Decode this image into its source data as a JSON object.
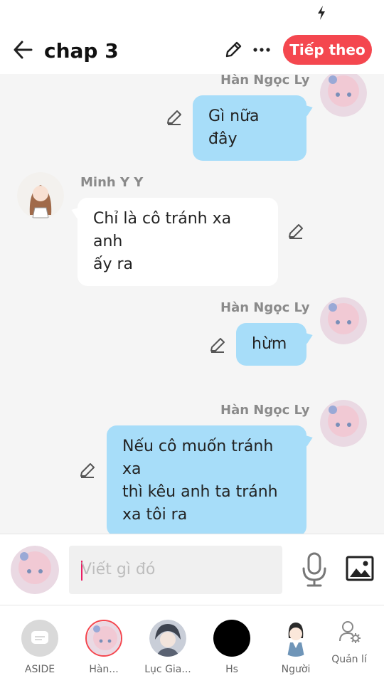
{
  "status": {
    "icon": "flash-icon"
  },
  "header": {
    "title": "chap 3",
    "back_icon": "arrow-left-icon",
    "edit_icon": "pencil-icon",
    "more_icon": "more-horizontal-icon",
    "follow_label": "Tiếp theo",
    "accent": "#f4474f"
  },
  "messages": [
    {
      "side": "right",
      "sender": "Hàn Ngọc Ly",
      "lines": [
        "Gì nữa đây"
      ]
    },
    {
      "side": "left",
      "sender": "Minh Y Y",
      "lines": [
        "Chỉ là cô tránh xa anh",
        "ấy ra"
      ]
    },
    {
      "side": "right",
      "sender": "Hàn Ngọc Ly",
      "lines": [
        "hừm"
      ]
    },
    {
      "side": "right",
      "sender": "Hàn Ngọc Ly",
      "lines": [
        "Nếu cô muốn tránh xa",
        "thì kêu anh ta tránh",
        "xa tôi ra"
      ]
    }
  ],
  "colors": {
    "right_bubble": "#a7ddf9",
    "left_bubble": "#ffffff"
  },
  "composer": {
    "placeholder": "Viết gì đó",
    "mic_icon": "microphone-icon",
    "image_icon": "image-icon"
  },
  "tabs": [
    {
      "label": "ASIDE",
      "icon": "aside-chat-icon"
    },
    {
      "label": "Hàn...",
      "icon": "avatar-han-ngoc-ly"
    },
    {
      "label": "Lục Gia...",
      "icon": "avatar-luc-gia"
    },
    {
      "label": "Hs",
      "icon": "black-circle-avatar"
    },
    {
      "label": "Người",
      "icon": "avatar-nguoi"
    },
    {
      "label": "Quản lí",
      "icon": "manage-user-gear-icon"
    }
  ]
}
